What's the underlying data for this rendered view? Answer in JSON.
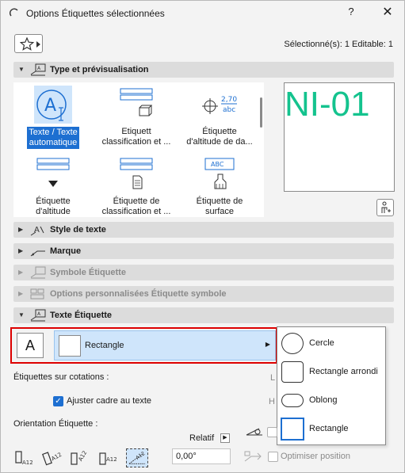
{
  "window": {
    "title": "Options Étiquettes sélectionnées",
    "help_label": "?",
    "close_label": "✕"
  },
  "selection_info": "Sélectionné(s): 1 Editable: 1",
  "sections": {
    "type_preview": "Type et prévisualisation",
    "style_texte": "Style de texte",
    "marque": "Marque",
    "symbole": "Symbole Étiquette",
    "options_perso": "Options personnalisées Étiquette symbole",
    "texte_etiquette": "Texte Étiquette"
  },
  "gallery": {
    "items": [
      {
        "line1": "Texte / Texte",
        "line2": "automatique",
        "selected": true
      },
      {
        "line1": "Etiquett",
        "line2": "classification et ..."
      },
      {
        "line1": "Étiquette",
        "line2": "d'altitude de da..."
      },
      {
        "line1": "Étiquette",
        "line2": "d'altitude"
      },
      {
        "line1": "Étiquette de",
        "line2": "classification et ..."
      },
      {
        "line1": "Étiquette de",
        "line2": "surface"
      }
    ],
    "icon_text_270": "2,70",
    "icon_text_abc": "abc",
    "icon_text_ABC": "ABC"
  },
  "preview": {
    "text": "NI-01",
    "color": "#14c38e"
  },
  "shape_row": {
    "a_label": "A",
    "selected_shape": "Rectangle"
  },
  "dropdown": {
    "items": [
      "Cercle",
      "Rectangle arrondi",
      "Oblong",
      "Rectangle"
    ]
  },
  "labels": {
    "etiquettes_cotations": "Étiquettes sur cotations :",
    "ajuster_cadre": "Ajuster cadre au texte",
    "orientation": "Orientation Étiquette :",
    "relatif": "Relatif",
    "angle_value": "0,00°",
    "optimiser": "Optimiser position",
    "l_letter": "L",
    "h_letter": "H"
  },
  "colors": {
    "accent": "#1d6fd1",
    "highlight_border": "#d00000"
  }
}
